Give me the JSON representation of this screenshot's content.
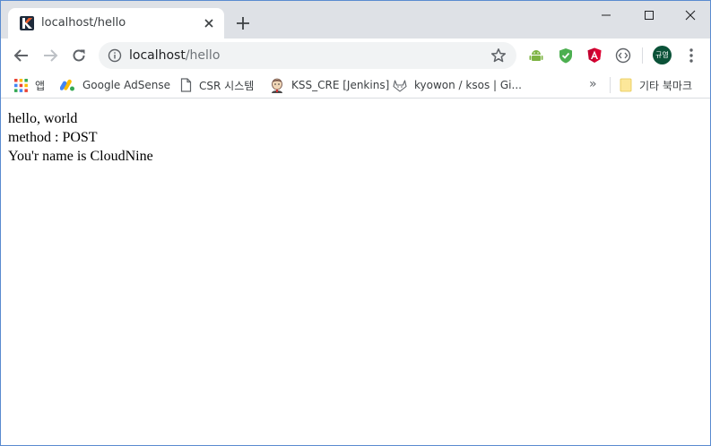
{
  "tab": {
    "title": "localhost/hello"
  },
  "omnibox": {
    "host": "localhost",
    "path": "/hello"
  },
  "bookmarks": {
    "items": [
      {
        "label": "앱",
        "icon": "apps-grid-icon"
      },
      {
        "label": "Google AdSense",
        "icon": "adsense-icon"
      },
      {
        "label": "CSR 시스템",
        "icon": "page-icon"
      },
      {
        "label": "KSS_CRE [Jenkins]",
        "icon": "jenkins-icon"
      },
      {
        "label": "kyowon / ksos | Gi...",
        "icon": "gitlab-icon"
      }
    ],
    "overflow": "»",
    "other_bookmarks": "기타 북마크"
  },
  "profile": {
    "initials": "규영"
  },
  "content": {
    "lines": [
      "hello, world",
      "method : POST",
      "You'r name is CloudNine"
    ]
  },
  "colors": {
    "tabstrip": "#dee1e6",
    "avatar": "#0b5238",
    "window_border": "#5a8bd0"
  }
}
